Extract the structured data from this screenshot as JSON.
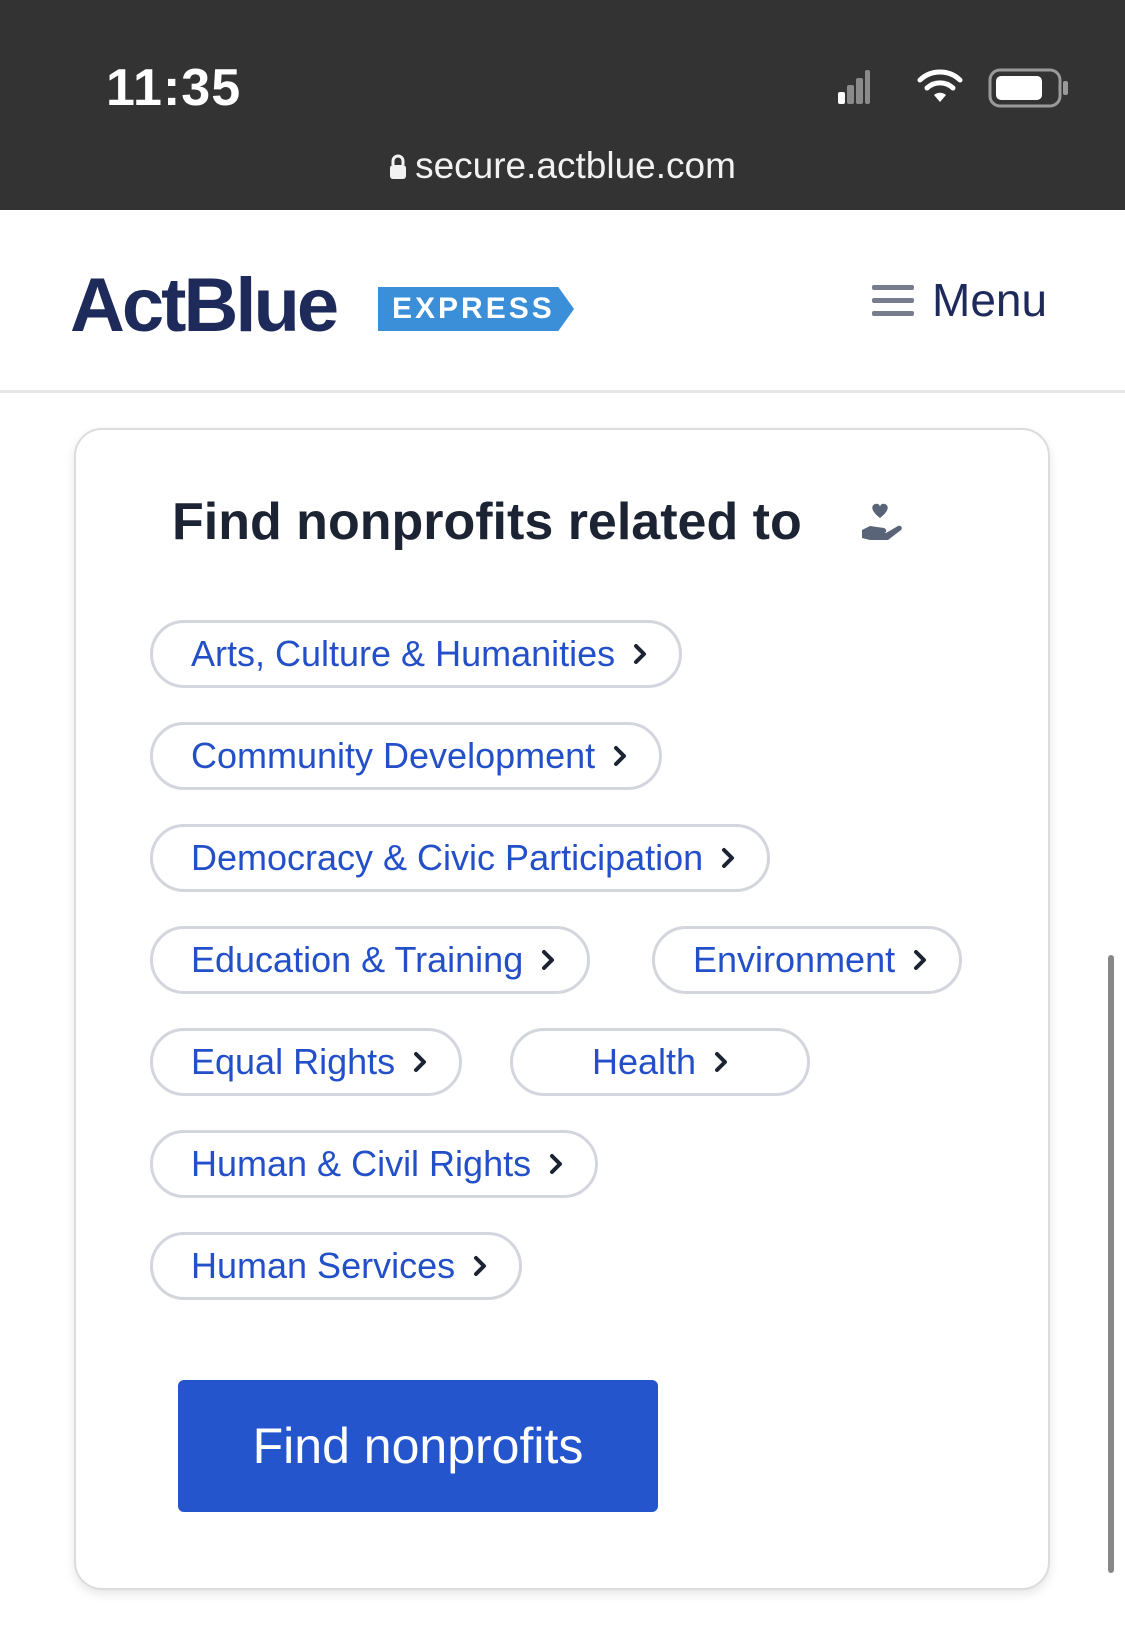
{
  "status_bar": {
    "time": "11:35",
    "url": "secure.actblue.com",
    "icons": [
      "signal-icon",
      "wifi-icon",
      "battery-icon",
      "lock-icon"
    ]
  },
  "header": {
    "logo_text": "ActBlue",
    "logo_badge": "EXPRESS",
    "menu_label": "Menu"
  },
  "card": {
    "title": "Find nonprofits related to",
    "categories": [
      "Arts, Culture & Humanities",
      "Community Development",
      "Democracy & Civic Participation",
      "Education & Training",
      "Environment",
      "Equal Rights",
      "Health",
      "Human & Civil Rights",
      "Human Services"
    ],
    "button_label": "Find nonprofits"
  },
  "colors": {
    "brand_navy": "#1e2a5a",
    "brand_light_blue": "#3b8ed8",
    "link_blue": "#2350c8",
    "button_blue": "#2455cc",
    "status_bar": "#333333"
  }
}
